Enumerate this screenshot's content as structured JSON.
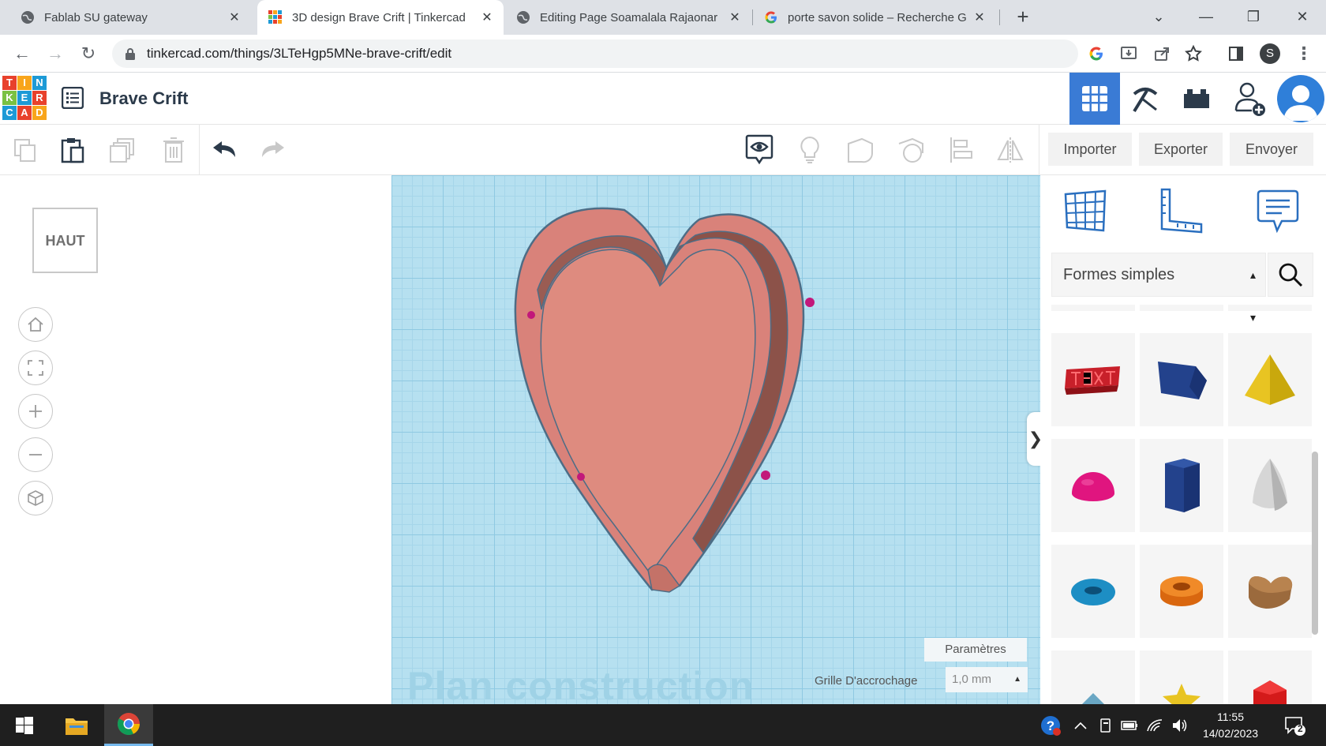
{
  "browser": {
    "tabs": [
      {
        "title": "Fablab SU gateway",
        "active": false
      },
      {
        "title": "3D design Brave Crift | Tinkercad",
        "active": true
      },
      {
        "title": "Editing Page Soamalala Rajaonar",
        "active": false
      },
      {
        "title": "porte savon solide – Recherche G",
        "active": false
      }
    ],
    "url": "tinkercad.com/things/3LTeHgp5MNe-brave-crift/edit",
    "profile_initial": "S"
  },
  "app": {
    "logo_letters": [
      "T",
      "I",
      "N",
      "K",
      "E",
      "R",
      "C",
      "A",
      "D"
    ],
    "logo_colors": [
      "#e8412c",
      "#f8a51b",
      "#1d9ad6",
      "#7ac143",
      "#1d9ad6",
      "#e8412c",
      "#1d9ad6",
      "#e8412c",
      "#f8a51b"
    ],
    "design_name": "Brave Crift"
  },
  "toolbar": {
    "import_label": "Importer",
    "export_label": "Exporter",
    "send_label": "Envoyer"
  },
  "viewcube": {
    "label": "HAUT"
  },
  "workplane": {
    "label": "Plan construction",
    "params_label": "Paramètres",
    "snap_label": "Grille D'accrochage",
    "snap_value": "1,0 mm"
  },
  "shapes_panel": {
    "category": "Formes simples",
    "tiles": [
      "text",
      "box",
      "pyramid",
      "half-sphere",
      "polygon",
      "paraboloid",
      "torus",
      "tube",
      "heart"
    ]
  },
  "taskbar": {
    "time": "11:55",
    "date": "14/02/2023",
    "notification_count": "2"
  },
  "colors": {
    "accent": "#3a7bd5",
    "workplane": "#b6e0f0",
    "heart": "#e0897c"
  }
}
